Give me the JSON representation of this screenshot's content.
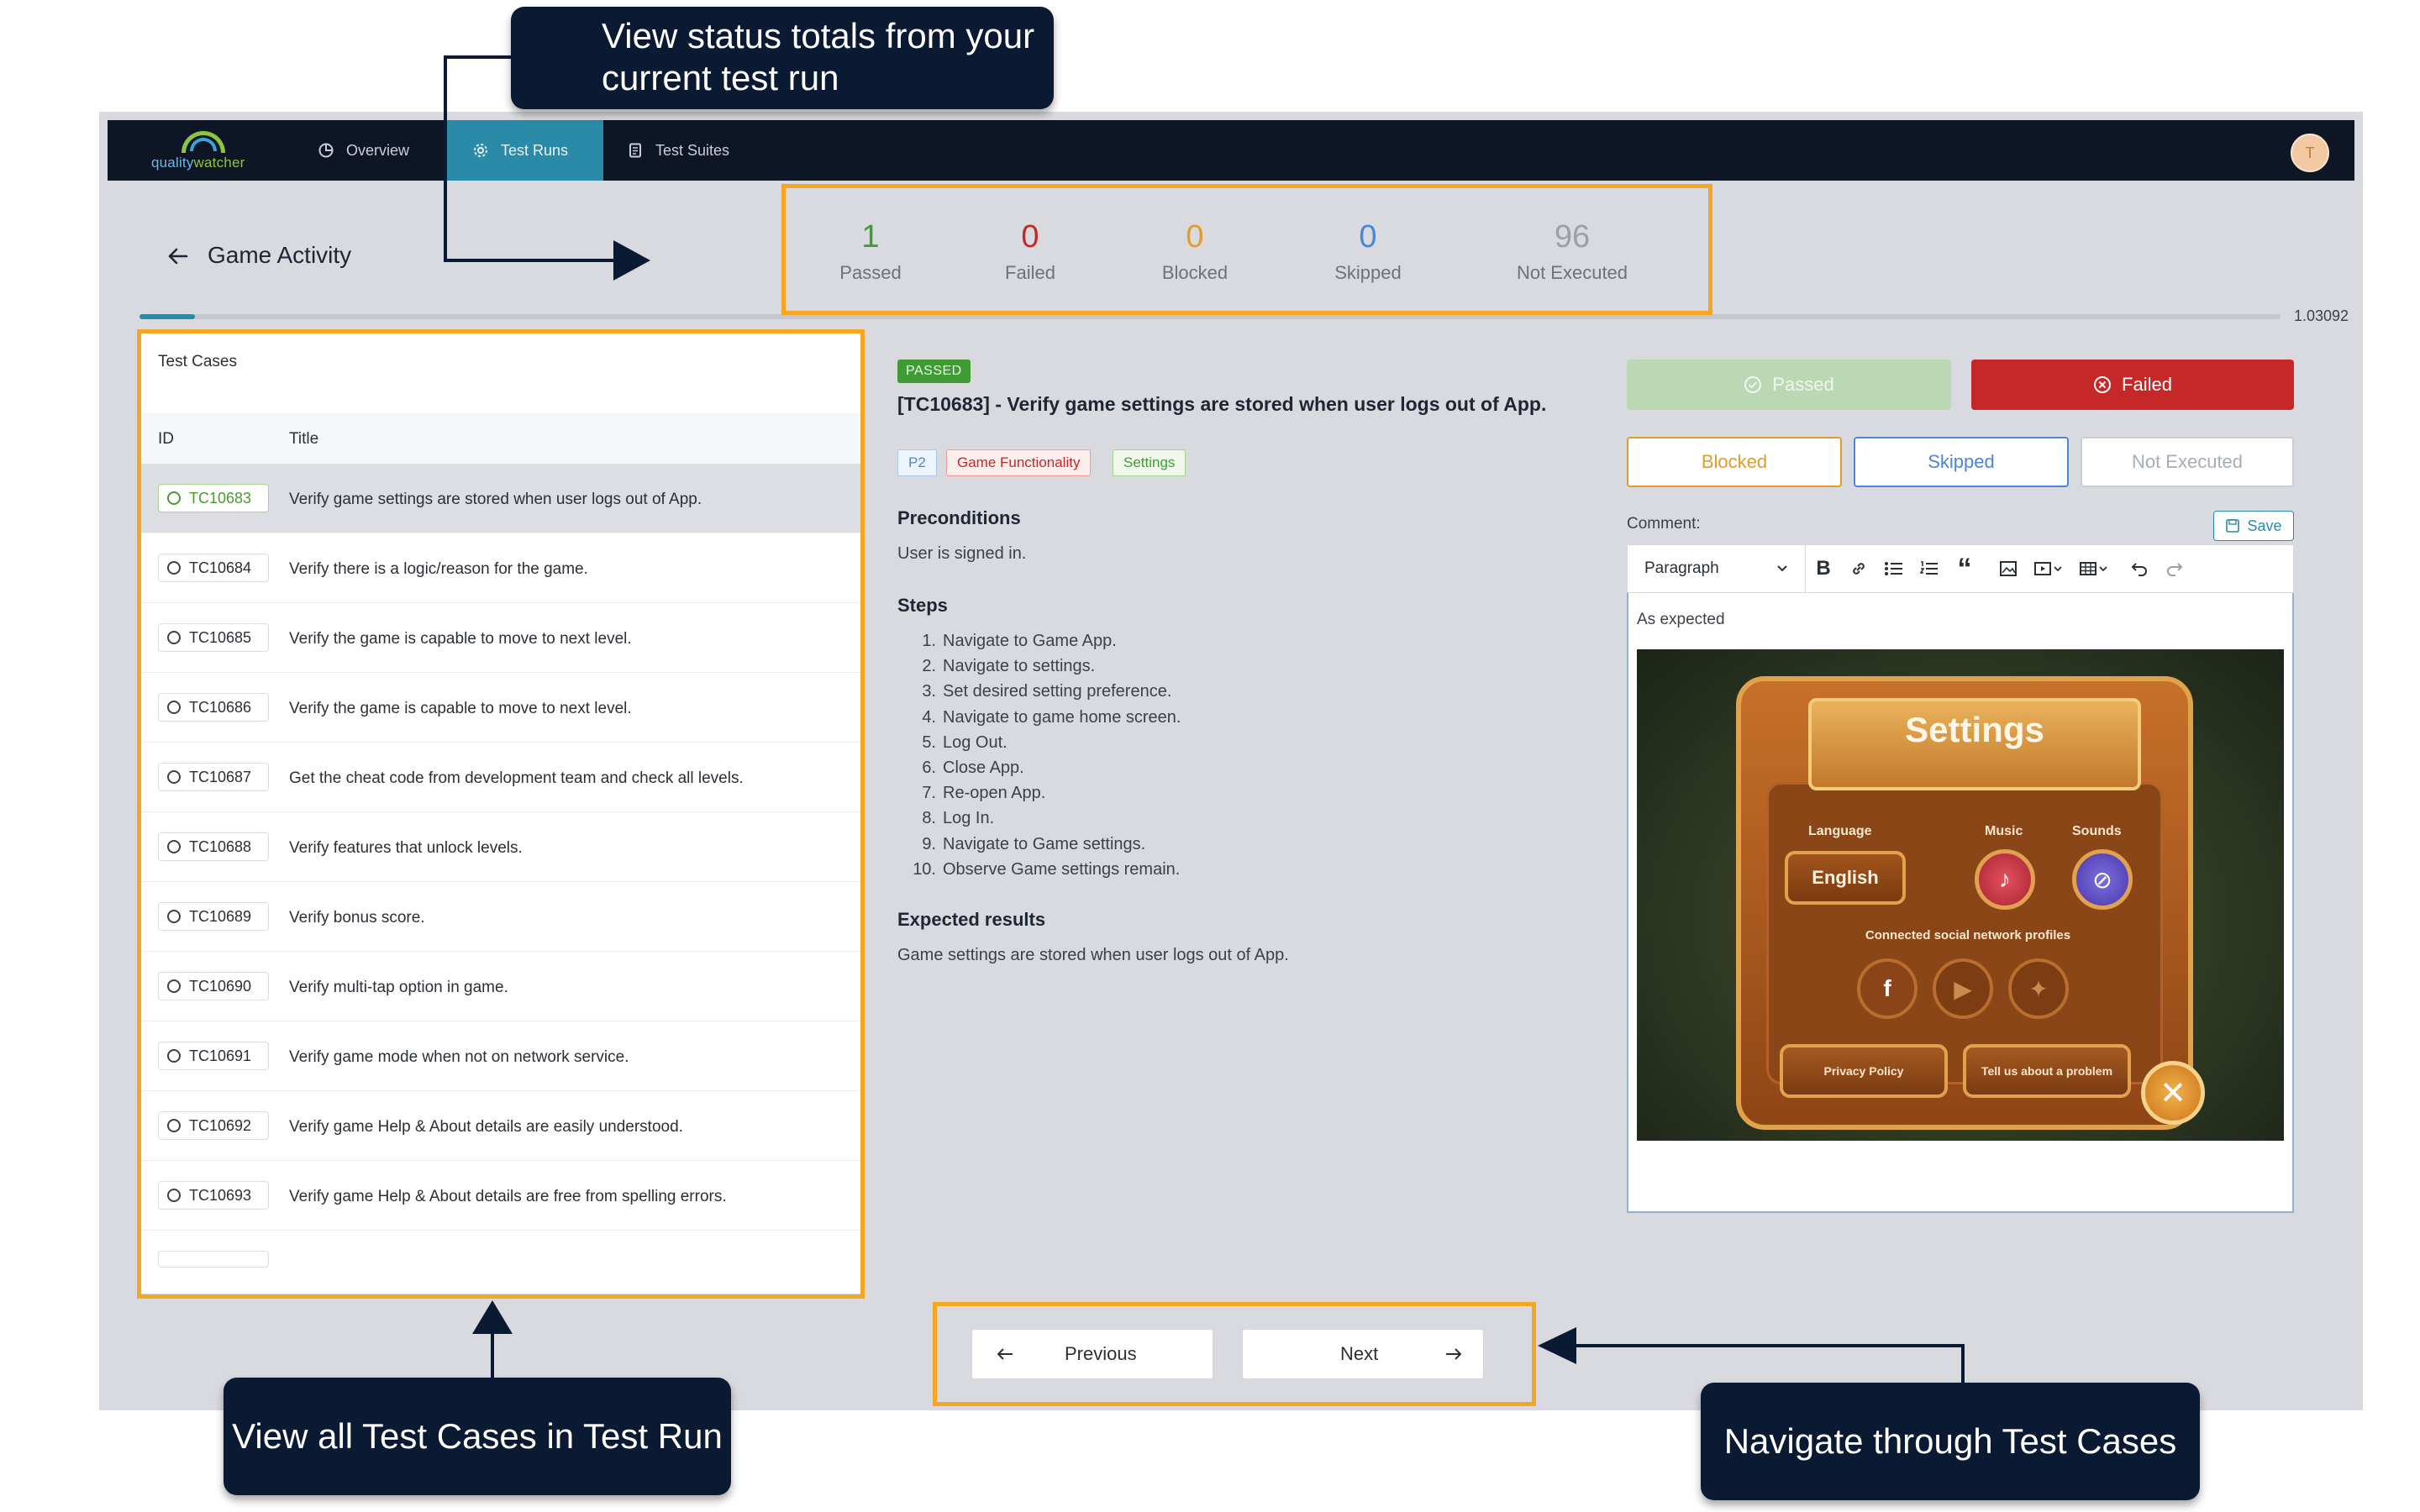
{
  "nav": {
    "logo_prefix": "quality",
    "logo_suffix": "watcher",
    "items": [
      {
        "label": "Overview",
        "icon": "overview-icon"
      },
      {
        "label": "Test Runs",
        "icon": "gear-icon"
      },
      {
        "label": "Test Suites",
        "icon": "document-icon"
      }
    ],
    "avatar_initial": "T"
  },
  "header": {
    "title": "Game Activity",
    "stats": [
      {
        "value": "1",
        "label": "Passed",
        "color": "#3f9c35"
      },
      {
        "value": "0",
        "label": "Failed",
        "color": "#c62828"
      },
      {
        "value": "0",
        "label": "Blocked",
        "color": "#e39b2c"
      },
      {
        "value": "0",
        "label": "Skipped",
        "color": "#4a86d6"
      },
      {
        "value": "96",
        "label": "Not Executed",
        "color": "#9aa0a8"
      }
    ],
    "progress": 0.0103092,
    "progress_text": "1.03092"
  },
  "list": {
    "heading": "Test Cases",
    "col_id": "ID",
    "col_title": "Title",
    "rows": [
      {
        "id": "TC10683",
        "title": "Verify game settings are stored when user logs out of App.",
        "selected": true
      },
      {
        "id": "TC10684",
        "title": "Verify there is a logic/reason for the game."
      },
      {
        "id": "TC10685",
        "title": "Verify the game is capable to move to next level."
      },
      {
        "id": "TC10686",
        "title": "Verify the game is capable to move to next level."
      },
      {
        "id": "TC10687",
        "title": "Get the cheat code from development team and check all levels."
      },
      {
        "id": "TC10688",
        "title": "Verify features that unlock levels."
      },
      {
        "id": "TC10689",
        "title": "Verify bonus score."
      },
      {
        "id": "TC10690",
        "title": "Verify multi-tap option in game."
      },
      {
        "id": "TC10691",
        "title": "Verify game mode when not on network service."
      },
      {
        "id": "TC10692",
        "title": "Verify game Help & About details are easily understood."
      },
      {
        "id": "TC10693",
        "title": "Verify game Help & About details are free from spelling errors."
      }
    ]
  },
  "detail": {
    "status": "PASSED",
    "title": "[TC10683] - Verify game settings are stored when user logs out of App.",
    "tags": [
      {
        "label": "P2",
        "color": "#4a86d6"
      },
      {
        "label": "Game Functionality",
        "color": "#c62828"
      },
      {
        "label": "Settings",
        "color": "#3f9c35"
      }
    ],
    "preconditions_h": "Preconditions",
    "preconditions": "User is signed in.",
    "steps_h": "Steps",
    "steps": [
      "Navigate to Game App.",
      "Navigate to settings.",
      "Set desired setting preference.",
      "Navigate to game home screen.",
      "Log Out.",
      "Close App.",
      "Re-open App.",
      "Log In.",
      "Navigate to Game settings.",
      "Observe Game settings remain."
    ],
    "expected_h": "Expected results",
    "expected": "Game settings are stored when user logs out of App."
  },
  "actions": {
    "passed": "Passed",
    "failed": "Failed",
    "blocked": "Blocked",
    "skipped": "Skipped",
    "not_executed": "Not Executed",
    "comment_label": "Comment:",
    "save": "Save",
    "format": "Paragraph",
    "editor_text": "As expected"
  },
  "game": {
    "title": "Settings",
    "language_lbl": "Language",
    "music_lbl": "Music",
    "sounds_lbl": "Sounds",
    "language_val": "English",
    "social_lbl": "Connected social network profiles",
    "privacy": "Privacy Policy",
    "problem": "Tell us about a problem"
  },
  "footer": {
    "previous": "Previous",
    "next": "Next"
  },
  "annotations": {
    "status_totals": "View status totals from your current test run",
    "test_cases": "View all Test Cases in Test Run",
    "navigate": "Navigate through Test Cases",
    "highlight_color": "#f5a623",
    "callout_color": "#0b1a33"
  }
}
